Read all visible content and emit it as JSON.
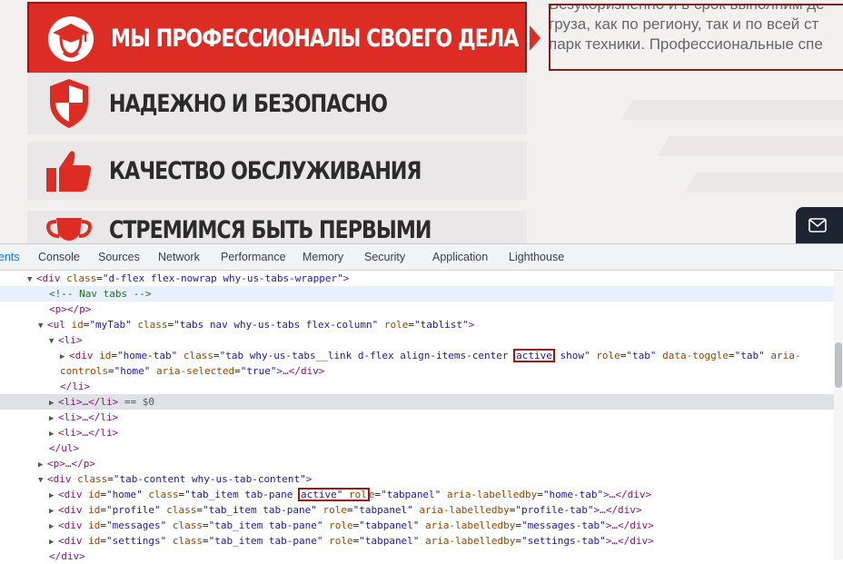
{
  "site": {
    "tabs": [
      {
        "label": "МЫ ПРОФЕССИОНАЛЫ СВОЕГО ДЕЛА",
        "icon": "graduate-cap-icon",
        "active": true
      },
      {
        "label": "НАДЕЖНО И БЕЗОПАСНО",
        "icon": "shield-icon",
        "active": false
      },
      {
        "label": "КАЧЕСТВО ОБСЛУЖИВАНИЯ",
        "icon": "thumbs-up-icon",
        "active": false
      },
      {
        "label": "СТРЕМИМСЯ БЫТЬ ПЕРВЫМИ",
        "icon": "trophy-cup-icon",
        "active": false
      }
    ],
    "description": [
      "Безукоризненно и в срок выполним де",
      "груза, как по региону, так и по всей ст",
      "парк техники. Профессиональные спе"
    ],
    "mail_icon": "mail-icon"
  },
  "devtools": {
    "tabs": [
      "ents",
      "Console",
      "Sources",
      "Network",
      "Performance",
      "Memory",
      "Security",
      "Application",
      "Lighthouse"
    ],
    "selected_tab": "ents",
    "lines": {
      "l1": {
        "open": "<div ",
        "a1": "class",
        "v1": "\"d-flex flex-nowrap why-us-tabs-wrapper\"",
        "close": ">"
      },
      "l2": "<!-- Nav tabs -->",
      "l3": "<p></p>",
      "l4": {
        "open": "<ul ",
        "a1": "id",
        "v1": "\"myTab\"",
        "a2": "class",
        "v2": "\"tabs nav why-us-tabs flex-column\"",
        "a3": "role",
        "v3": "\"tablist\"",
        "close": ">"
      },
      "l5": "<li>",
      "l6": {
        "open": "<div ",
        "a1": "id",
        "v1": "\"home-tab\"",
        "a2": "class",
        "v2a": "\"tab why-us-tabs__link d-flex align-items-center ",
        "v2hl": "active",
        "v2b": " show\"",
        "a3": "role",
        "v3": "\"tab\"",
        "a4": "data-toggle",
        "v4": "\"tab\"",
        "a5": "aria-"
      },
      "l7": {
        "a5b": "controls",
        "v5": "\"home\"",
        "a6": "aria-selected",
        "v6": "\"true\"",
        "close": ">…</div>"
      },
      "l8": "</li>",
      "l9": {
        "tag": "<li>…</li>",
        "eq": " == $0"
      },
      "l10": "<li>…</li>",
      "l11": "<li>…</li>",
      "l12": "</ul>",
      "l13": "<p>…</p>",
      "l14": {
        "open": "<div ",
        "a1": "class",
        "v1": "\"tab-content why-us-tab-content\"",
        "close": ">"
      },
      "l15": {
        "open": "<div ",
        "a1": "id",
        "v1": "\"home\"",
        "a2": "class",
        "v2a": "\"tab_item tab-pane ",
        "v2hl": "active\"",
        "a3a": " rol",
        "a3b": "e",
        "v3": "\"tabpanel\"",
        "a4": "aria-labelledby",
        "v4": "\"home-tab\"",
        "close": ">…</div>"
      },
      "l16": {
        "open": "<div ",
        "a1": "id",
        "v1": "\"profile\"",
        "a2": "class",
        "v2": "\"tab_item tab-pane\"",
        "a3": "role",
        "v3": "\"tabpanel\"",
        "a4": "aria-labelledby",
        "v4": "\"profile-tab\"",
        "close": ">…</div>"
      },
      "l17": {
        "open": "<div ",
        "a1": "id",
        "v1": "\"messages\"",
        "a2": "class",
        "v2": "\"tab_item tab-pane\"",
        "a3": "role",
        "v3": "\"tabpanel\"",
        "a4": "aria-labelledby",
        "v4": "\"messages-tab\"",
        "close": ">…</div>"
      },
      "l18": {
        "open": "<div ",
        "a1": "id",
        "v1": "\"settings\"",
        "a2": "class",
        "v2": "\"tab_item tab-pane\"",
        "a3": "role",
        "v3": "\"tabpanel\"",
        "a4": "aria-labelledby",
        "v4": "\"settings-tab\"",
        "close": ">…</div>"
      },
      "l19": "</div>"
    }
  },
  "colors": {
    "brand_red": "#dd2c24",
    "highlight_border": "#8a1b16",
    "devtools_selected": "#1a73e8"
  }
}
